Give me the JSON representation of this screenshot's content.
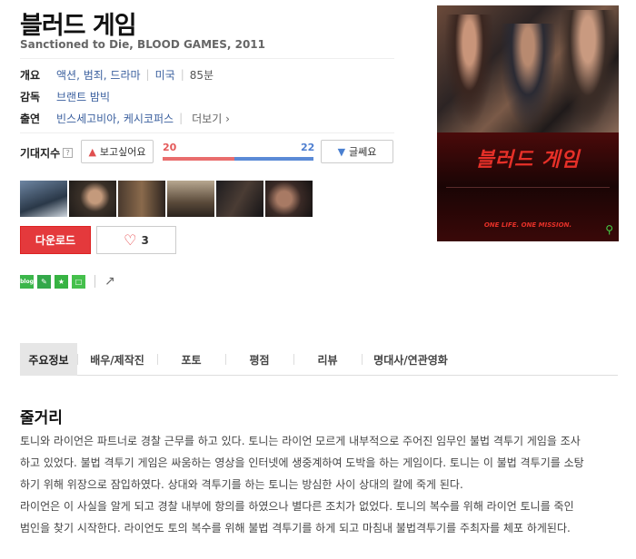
{
  "movie": {
    "title": "블러드 게임",
    "subtitle": "Sanctioned to Die, BLOOD GAMES, 2011"
  },
  "info": {
    "genre_label": "개요",
    "genres": "액션, 범죄, 드라마",
    "country": "미국",
    "runtime": "85분",
    "director_label": "감독",
    "director": "브랜트 밤빅",
    "cast_label": "출연",
    "cast": "빈스세고비아, 케시코퍼스",
    "more_label": "더보기"
  },
  "expectation": {
    "label": "기대지수",
    "help": "?",
    "want_label": "보고싶어요",
    "dontwant_label": "글쎄요",
    "want_count": "20",
    "dontwant_count": "22"
  },
  "actions": {
    "download_label": "다운로드",
    "like_count": "3"
  },
  "share": {
    "blog_label": "blog"
  },
  "tabs": [
    {
      "label": "주요정보"
    },
    {
      "label": "배우/제작진"
    },
    {
      "label": "포토"
    },
    {
      "label": "평점"
    },
    {
      "label": "리뷰"
    },
    {
      "label": "명대사/연관영화"
    }
  ],
  "synopsis": {
    "title": "줄거리",
    "lines": [
      "토니와 라이언은 파트너로 경찰 근무를 하고 있다. 토니는 라이언 모르게 내부적으로 주어진 임무인 불법 격투기 게임을 조사",
      "하고 있었다. 불법 격투기 게임은 싸움하는 영상을 인터넷에 생중계하여 도박을 하는 게임이다. 토니는 이 불법 격투기를 소탕",
      "하기 위해 위장으로 잠입하였다. 상대와 격투기를 하는 토니는 방심한 사이 상대의 칼에 죽게 된다.",
      " 라이언은 이 사실을 알게 되고 경찰 내부에 항의를 하였으나 별다른 조치가 없었다. 토니의 복수를 위해 라이언 토니를 죽인",
      "범인을 찾기 시작한다. 라이언도 토의 복수를 위해 불법 격투기를 하게 되고 마침내 불법격투기를 주최자를 체포 하게된다."
    ]
  },
  "poster": {
    "title": "블러드 게임",
    "tagline": "ONE LIFE. ONE MISSION."
  },
  "colors": {
    "download": "#e4393c",
    "want": "#e45a5a",
    "dontwant": "#4f7fd0",
    "link": "#3a5f9e"
  }
}
